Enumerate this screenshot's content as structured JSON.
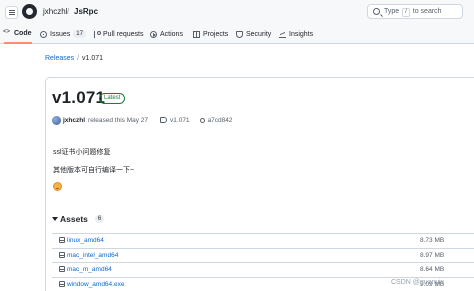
{
  "header": {
    "owner": "jxhczhl",
    "separator": "/",
    "repo": "JsRpc",
    "search": {
      "prefix": "Type",
      "key": "/",
      "suffix": "to search"
    }
  },
  "tabs": [
    {
      "label": "Code",
      "icon": "code-icon",
      "active": true
    },
    {
      "label": "Issues",
      "icon": "issue-icon",
      "count": "17"
    },
    {
      "label": "Pull requests",
      "icon": "pull-request-icon"
    },
    {
      "label": "Actions",
      "icon": "play-icon"
    },
    {
      "label": "Projects",
      "icon": "table-icon"
    },
    {
      "label": "Security",
      "icon": "shield-icon"
    },
    {
      "label": "Insights",
      "icon": "graph-icon"
    }
  ],
  "breadcrumb": {
    "releases": "Releases",
    "separator": "/",
    "current": "v1.071"
  },
  "release": {
    "title": "v1.071",
    "badge": "Latest",
    "author": "jxhczhl",
    "released_text": "released this May 27",
    "tag": "v1.071",
    "commit": "a7cd842",
    "notes": [
      "ssl证书小问题修复",
      "其他版本可自行编译一下~"
    ]
  },
  "assets": {
    "heading": "Assets",
    "count": "6",
    "items": [
      {
        "name": "linux_amd64",
        "size": "8.73 MB"
      },
      {
        "name": "mac_intel_amd64",
        "size": "8.97 MB"
      },
      {
        "name": "mac_m_amd64",
        "size": "8.64 MB"
      },
      {
        "name": "window_amd64.exe",
        "size": "9.09 MB"
      }
    ]
  },
  "watermark": "CSDN @guanyix",
  "colors": {
    "accent": "#0969da",
    "latest": "#1a7f37",
    "tab_underline": "#fd8c73"
  }
}
